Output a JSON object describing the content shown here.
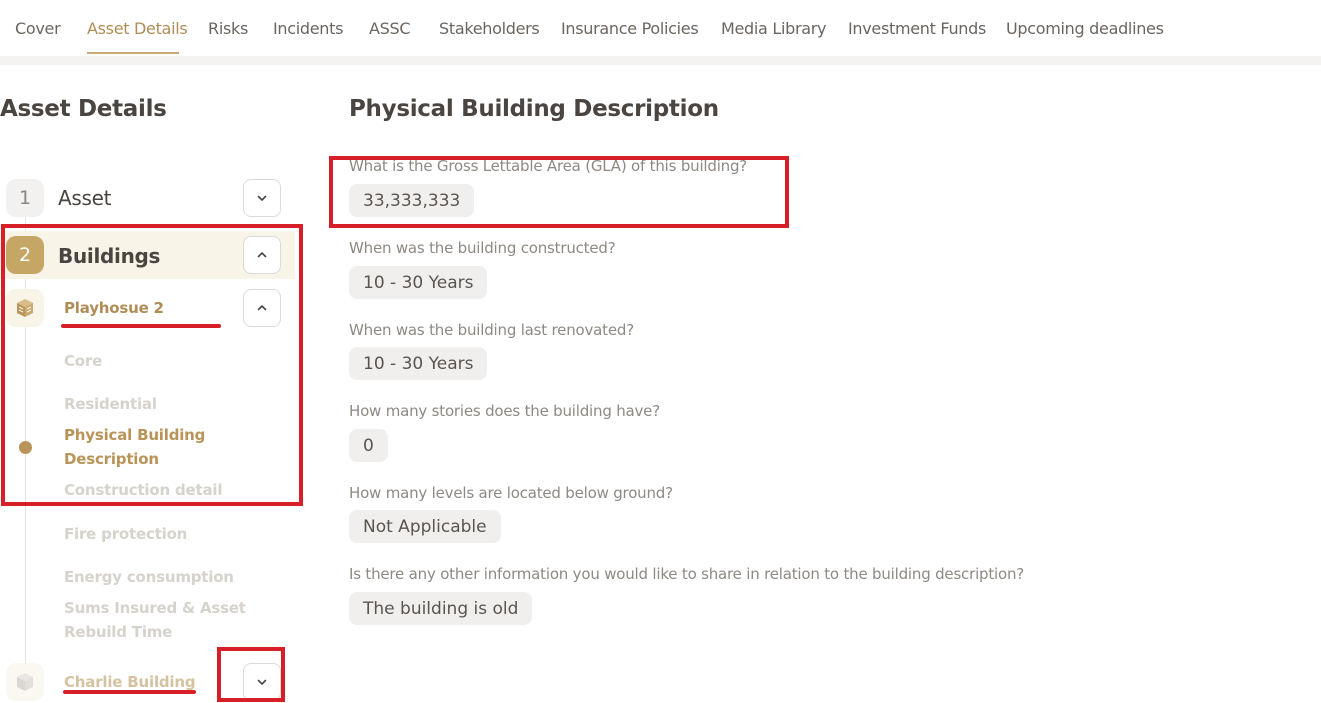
{
  "tabs": [
    {
      "label": "Cover",
      "active": false
    },
    {
      "label": "Asset Details",
      "active": true
    },
    {
      "label": "Risks",
      "active": false
    },
    {
      "label": "Incidents",
      "active": false
    },
    {
      "label": "ASSC",
      "active": false
    },
    {
      "label": "Stakeholders",
      "active": false
    },
    {
      "label": "Insurance Policies",
      "active": false
    },
    {
      "label": "Media Library",
      "active": false
    },
    {
      "label": "Investment Funds",
      "active": false
    },
    {
      "label": "Upcoming deadlines",
      "active": false
    }
  ],
  "sidebar": {
    "title": "Asset Details",
    "steps": [
      {
        "number": "1",
        "label": "Asset"
      },
      {
        "number": "2",
        "label": "Buildings"
      }
    ],
    "buildings": [
      {
        "name": "Playhosue 2",
        "icon": "building-icon",
        "sections": [
          "Core",
          "Residential",
          "Physical Building Description",
          "Construction detail",
          "Fire protection",
          "Energy consumption",
          "Sums Insured & Asset Rebuild Time"
        ],
        "current_section": "Physical Building Description"
      },
      {
        "name": "Charlie Building",
        "icon": "building-icon"
      }
    ]
  },
  "main": {
    "title": "Physical Building Description",
    "questions": [
      {
        "question": "What is the Gross Lettable Area (GLA) of this building?",
        "answer": "33,333,333"
      },
      {
        "question": "When was the building constructed?",
        "answer": "10 - 30 Years"
      },
      {
        "question": "When was the building last renovated?",
        "answer": "10 - 30 Years"
      },
      {
        "question": "How many stories does the building have?",
        "answer": "0"
      },
      {
        "question": "How many levels are located below ground?",
        "answer": "Not Applicable"
      },
      {
        "question": "Is there any other information you would like to share in relation to the building description?",
        "answer": "The building is old"
      }
    ]
  },
  "colors": {
    "accent": "#b08d57",
    "step_active_bg": "#c6a664",
    "annotation_red": "#d61f26"
  }
}
